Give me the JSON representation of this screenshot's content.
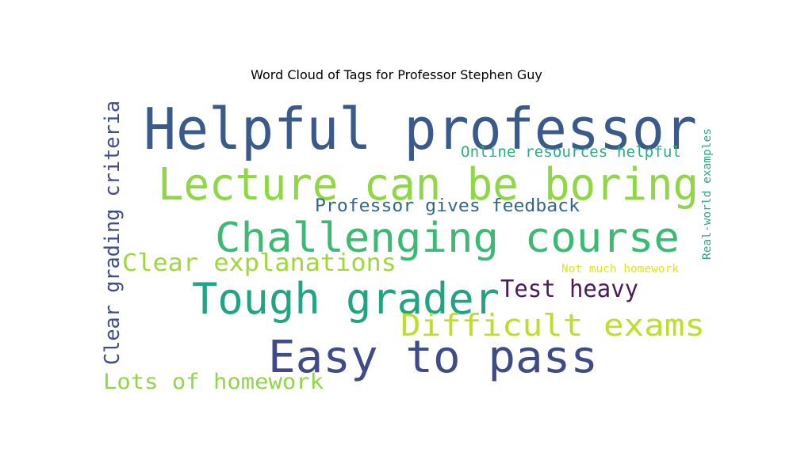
{
  "chart_data": {
    "type": "wordcloud",
    "title": "Word Cloud of Tags for Professor Stephen Guy",
    "background": "#ffffff",
    "words": [
      {
        "text": "Helpful professor",
        "color": "#3a5a8c"
      },
      {
        "text": "Lecture can be boring",
        "color": "#8fd744"
      },
      {
        "text": "Challenging course",
        "color": "#3cba74"
      },
      {
        "text": "Tough grader",
        "color": "#22a383"
      },
      {
        "text": "Easy to pass",
        "color": "#3f4a89"
      },
      {
        "text": "Difficult exams",
        "color": "#bcdf27"
      },
      {
        "text": "Clear explanations",
        "color": "#9dd93b"
      },
      {
        "text": "Professor gives feedback",
        "color": "#32678d"
      },
      {
        "text": "Test heavy",
        "color": "#4a1a5e"
      },
      {
        "text": "Lots of homework",
        "color": "#8fd744"
      },
      {
        "text": "Clear grading criteria",
        "color": "#3f4e8a"
      },
      {
        "text": "Online resources helpful",
        "color": "#2ab07f"
      },
      {
        "text": "Real-world examples",
        "color": "#2ba98a"
      },
      {
        "text": "Not much homework",
        "color": "#e3e418"
      }
    ]
  }
}
